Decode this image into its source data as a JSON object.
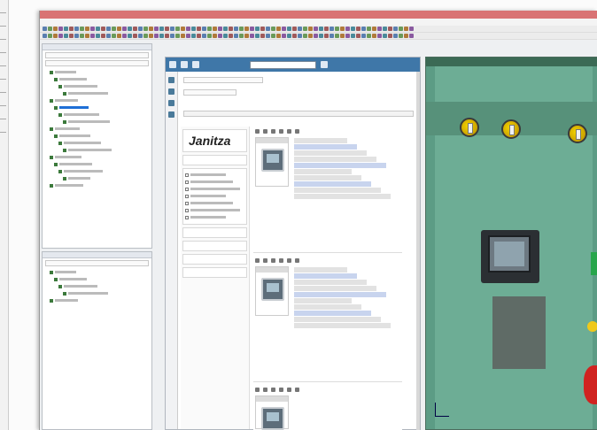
{
  "catalog": {
    "panel_title": "Janitza",
    "brand": "Janitza"
  },
  "colors": {
    "titlebar": "#d97374",
    "catalog_toolbar": "#3f77a8",
    "view_background": "#5c9c85",
    "selection": "#1e6fd6",
    "knob": "#f3d200",
    "red_device": "#d02320",
    "green_indicator": "#28a64c"
  },
  "icons": [
    "window-icon",
    "toolbar-icon",
    "tree-folder-icon",
    "search-icon",
    "filter-icon",
    "meter-thumbnail-icon",
    "axis-gizmo-icon"
  ]
}
